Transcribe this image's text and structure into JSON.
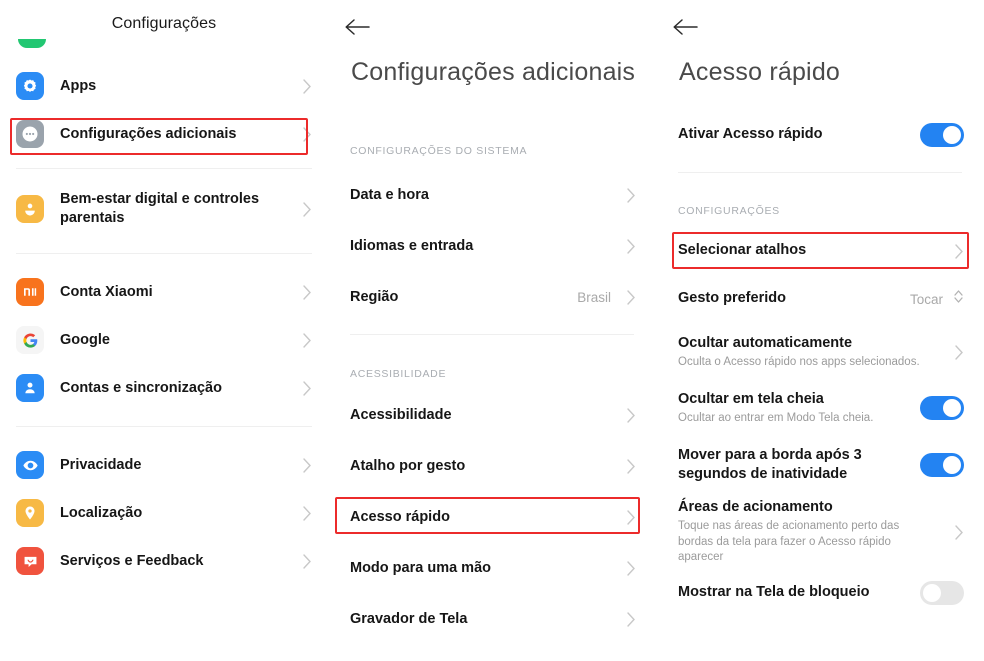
{
  "panel1": {
    "title": "Configurações",
    "items": [
      {
        "label": "Apps",
        "icon": "apps-gear-icon",
        "color": "#2b8cf5",
        "chevron": true
      },
      {
        "label": "Configurações adicionais",
        "icon": "additional-settings-dots-icon",
        "color": "#9aa3ac",
        "chevron": true,
        "highlighted": true
      },
      {
        "label": "Bem-estar digital e controles parentais",
        "icon": "digital-wellbeing-person-icon",
        "color": "#f7b945",
        "chevron": true
      },
      {
        "label": "Conta Xiaomi",
        "icon": "xiaomi-mi-icon",
        "color": "#f8731d",
        "chevron": true
      },
      {
        "label": "Google",
        "icon": "google-g-icon",
        "color": "#f5f5f5",
        "chevron": true
      },
      {
        "label": "Contas e sincronização",
        "icon": "accounts-sync-person-icon",
        "color": "#2b8cf5",
        "chevron": true
      },
      {
        "label": "Privacidade",
        "icon": "privacy-eye-icon",
        "color": "#2b8cf5",
        "chevron": true
      },
      {
        "label": "Localização",
        "icon": "location-pin-icon",
        "color": "#f7b945",
        "chevron": true
      },
      {
        "label": "Serviços e Feedback",
        "icon": "services-feedback-chat-icon",
        "color": "#f0533e",
        "chevron": true
      }
    ]
  },
  "panel2": {
    "back_icon": "back-arrow-icon",
    "title": "Configurações adicionais",
    "section1_header": "CONFIGURAÇÕES DO SISTEMA",
    "section1_items": [
      {
        "label": "Data e hora",
        "value": ""
      },
      {
        "label": "Idiomas e entrada",
        "value": ""
      },
      {
        "label": "Região",
        "value": "Brasil"
      }
    ],
    "section2_header": "ACESSIBILIDADE",
    "section2_items": [
      {
        "label": "Acessibilidade",
        "value": ""
      },
      {
        "label": "Atalho por gesto",
        "value": ""
      },
      {
        "label": "Acesso rápido",
        "value": "",
        "highlighted": true
      },
      {
        "label": "Modo para uma mão",
        "value": ""
      },
      {
        "label": "Gravador de Tela",
        "value": ""
      }
    ]
  },
  "panel3": {
    "back_icon": "back-arrow-icon",
    "title": "Acesso rápido",
    "master": {
      "label": "Ativar Acesso rápido",
      "state": "on"
    },
    "section_header": "CONFIGURAÇÕES",
    "items": [
      {
        "label": "Selecionar atalhos",
        "sub": "",
        "control": "chevron",
        "highlighted": true
      },
      {
        "label": "Gesto preferido",
        "sub": "",
        "control": "value",
        "value": "Tocar"
      },
      {
        "label": "Ocultar automaticamente",
        "sub": "Oculta o Acesso rápido nos apps selecionados.",
        "control": "chevron"
      },
      {
        "label": "Ocultar em tela cheia",
        "sub": "Ocultar ao entrar em Modo Tela cheia.",
        "control": "toggle",
        "state": "on"
      },
      {
        "label": "Mover para a borda após 3 segundos de inatividade",
        "sub": "",
        "control": "toggle",
        "state": "on"
      },
      {
        "label": "Áreas de acionamento",
        "sub": "Toque nas áreas de acionamento perto das bordas da tela para fazer o Acesso rápido aparecer",
        "control": "chevron"
      },
      {
        "label": "Mostrar na Tela de bloqueio",
        "sub": "",
        "control": "toggle",
        "state": "off"
      }
    ]
  },
  "colors": {
    "highlight_box": "#ec2b2b",
    "toggle_on": "#2383f2",
    "toggle_off": "#e6e6e6"
  }
}
